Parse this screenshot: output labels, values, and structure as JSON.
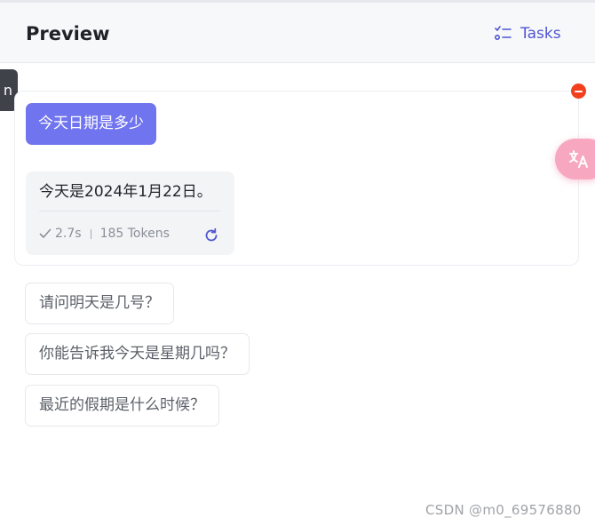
{
  "header": {
    "title": "Preview",
    "tasks_label": "Tasks"
  },
  "side_tab": {
    "label": "n"
  },
  "chat": {
    "user_message": "今天日期是多少",
    "bot_message": "今天是2024年1月22日。",
    "duration": "2.7s",
    "tokens": "185 Tokens"
  },
  "suggestions": [
    "请问明天是几号？",
    "你能告诉我今天是星期几吗？",
    "最近的假期是什么时候？"
  ],
  "icons": {
    "tasks": "checklist-icon",
    "remove": "remove-icon",
    "translate": "translate-icon",
    "check": "check-icon",
    "refresh": "refresh-icon"
  },
  "colors": {
    "accent": "#4f55d1",
    "user_bubble": "#7074ee",
    "remove": "#f2401e",
    "translate_fab": "#f7a7c0"
  },
  "watermark": "CSDN @m0_69576880"
}
